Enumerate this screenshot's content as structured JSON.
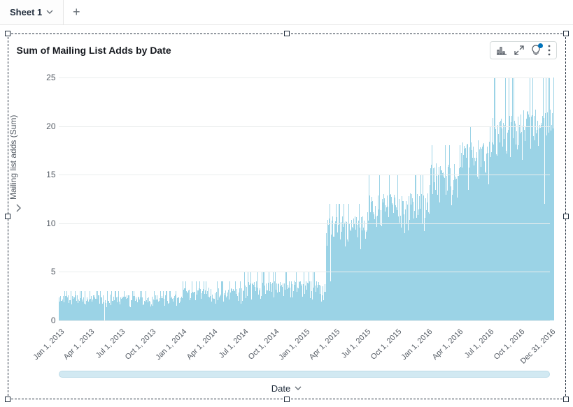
{
  "tabs": {
    "active_label": "Sheet 1"
  },
  "chart_title": "Sum of Mailing List Adds by Date",
  "ylabel": "Mailing list adds (Sum)",
  "xlabel": "Date",
  "chart_data": {
    "type": "bar",
    "title": "Sum of Mailing List Adds by Date",
    "xlabel": "Date",
    "ylabel": "Mailing list adds (Sum)",
    "ylim": [
      0,
      25
    ],
    "y_ticks": [
      0,
      5,
      10,
      15,
      20,
      25
    ],
    "x_tick_labels": [
      "Jan 1, 2013",
      "Apr 1, 2013",
      "Jul 1, 2013",
      "Oct 1, 2013",
      "Jan 1, 2014",
      "Apr 1, 2014",
      "Jul 1, 2014",
      "Oct 1, 2014",
      "Jan 1, 2015",
      "Apr 1, 2015",
      "Jul 1, 2015",
      "Oct 1, 2015",
      "Jan 1, 2016",
      "Apr 1, 2016",
      "Jul 1, 2016",
      "Oct 1, 2016",
      "Dec 31, 2016"
    ],
    "categories_note": "Daily bars from Jan 1 2013 to Dec 31 2016 (approx 1461 days). Values are approximate readings from the chart.",
    "series": [
      {
        "name": "Mailing list adds",
        "color": "#9bd3e6",
        "segments": [
          {
            "start": "2013-01-01",
            "end": "2013-12-31",
            "min": 0,
            "max": 3,
            "typical": 2
          },
          {
            "start": "2014-01-01",
            "end": "2014-06-30",
            "min": 0,
            "max": 4,
            "typical": 2.5
          },
          {
            "start": "2014-07-01",
            "end": "2014-12-31",
            "min": 0,
            "max": 5,
            "typical": 3
          },
          {
            "start": "2015-01-01",
            "end": "2015-02-28",
            "min": 0,
            "max": 5,
            "typical": 3
          },
          {
            "start": "2015-03-01",
            "end": "2015-06-30",
            "min": 4,
            "max": 12,
            "typical": 9
          },
          {
            "start": "2015-07-01",
            "end": "2015-12-31",
            "min": 5,
            "max": 15,
            "typical": 11
          },
          {
            "start": "2016-01-01",
            "end": "2016-03-31",
            "min": 8,
            "max": 18,
            "typical": 14
          },
          {
            "start": "2016-04-01",
            "end": "2016-06-30",
            "min": 8,
            "max": 20,
            "typical": 16
          },
          {
            "start": "2016-07-01",
            "end": "2016-09-30",
            "min": 10,
            "max": 25,
            "typical": 18
          },
          {
            "start": "2016-10-01",
            "end": "2016-12-31",
            "min": 12,
            "max": 25,
            "typical": 19
          }
        ]
      }
    ]
  }
}
